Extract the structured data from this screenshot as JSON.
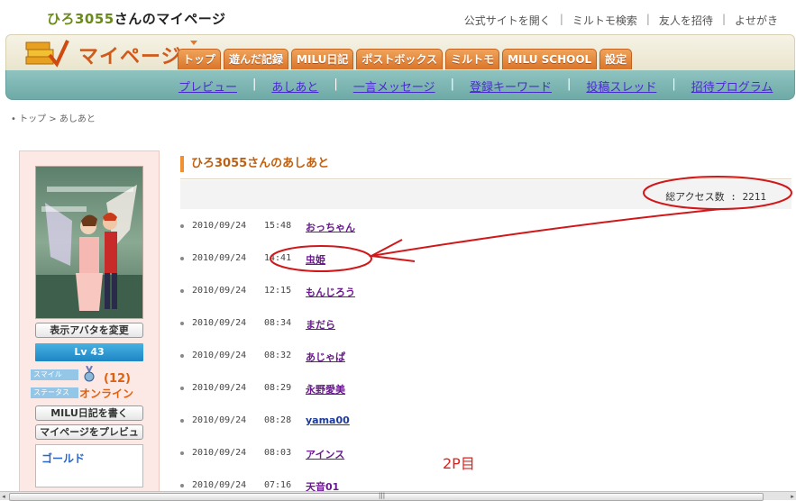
{
  "header": {
    "user_name": "ひろ3055",
    "title_suffix": "さんのマイページ",
    "links": [
      "公式サイトを開く",
      "ミルトモ検索",
      "友人を招待",
      "よせがき"
    ],
    "logo_text": "マイページ"
  },
  "tabs": [
    "トップ",
    "遊んだ記録",
    "MILU日記",
    "ポストボックス",
    "ミルトモ",
    "MILU SCHOOL",
    "設定"
  ],
  "subnav": [
    "プレビュー",
    "あしあと",
    "一言メッセージ",
    "登録キーワード",
    "投稿スレッド",
    "招待プログラム"
  ],
  "breadcrumb": "• トップ > あしあと",
  "sidebar": {
    "change_avatar": "表示アバタを変更",
    "level": "Lv 43",
    "smile_label": "スマイル",
    "smile_value": "(12)",
    "status_label": "ステータス",
    "status_value": "オンライン",
    "write_diary": "MILU日記を書く",
    "preview_page": "マイページをプレビュー",
    "gold_label": "ゴールド"
  },
  "main": {
    "heading": "ひろ3055さんのあしあと",
    "total_access": "総アクセス数 : 2211",
    "visitors": [
      {
        "date": "2010/09/24",
        "time": "15:48",
        "name": "おっちゃん"
      },
      {
        "date": "2010/09/24",
        "time": "14:41",
        "name": "虫姫"
      },
      {
        "date": "2010/09/24",
        "time": "12:15",
        "name": "もんじろう"
      },
      {
        "date": "2010/09/24",
        "time": "08:34",
        "name": "まだら"
      },
      {
        "date": "2010/09/24",
        "time": "08:32",
        "name": "あじゃぱ"
      },
      {
        "date": "2010/09/24",
        "time": "08:29",
        "name": "永野愛美"
      },
      {
        "date": "2010/09/24",
        "time": "08:28",
        "name": "yama00"
      },
      {
        "date": "2010/09/24",
        "time": "08:03",
        "name": "アインス"
      },
      {
        "date": "2010/09/24",
        "time": "07:16",
        "name": "天音01"
      }
    ],
    "page_note": "2P目"
  },
  "colors": {
    "annotation": "#d0181a",
    "accent": "#f09030",
    "subnav": "#7ab4b1"
  }
}
